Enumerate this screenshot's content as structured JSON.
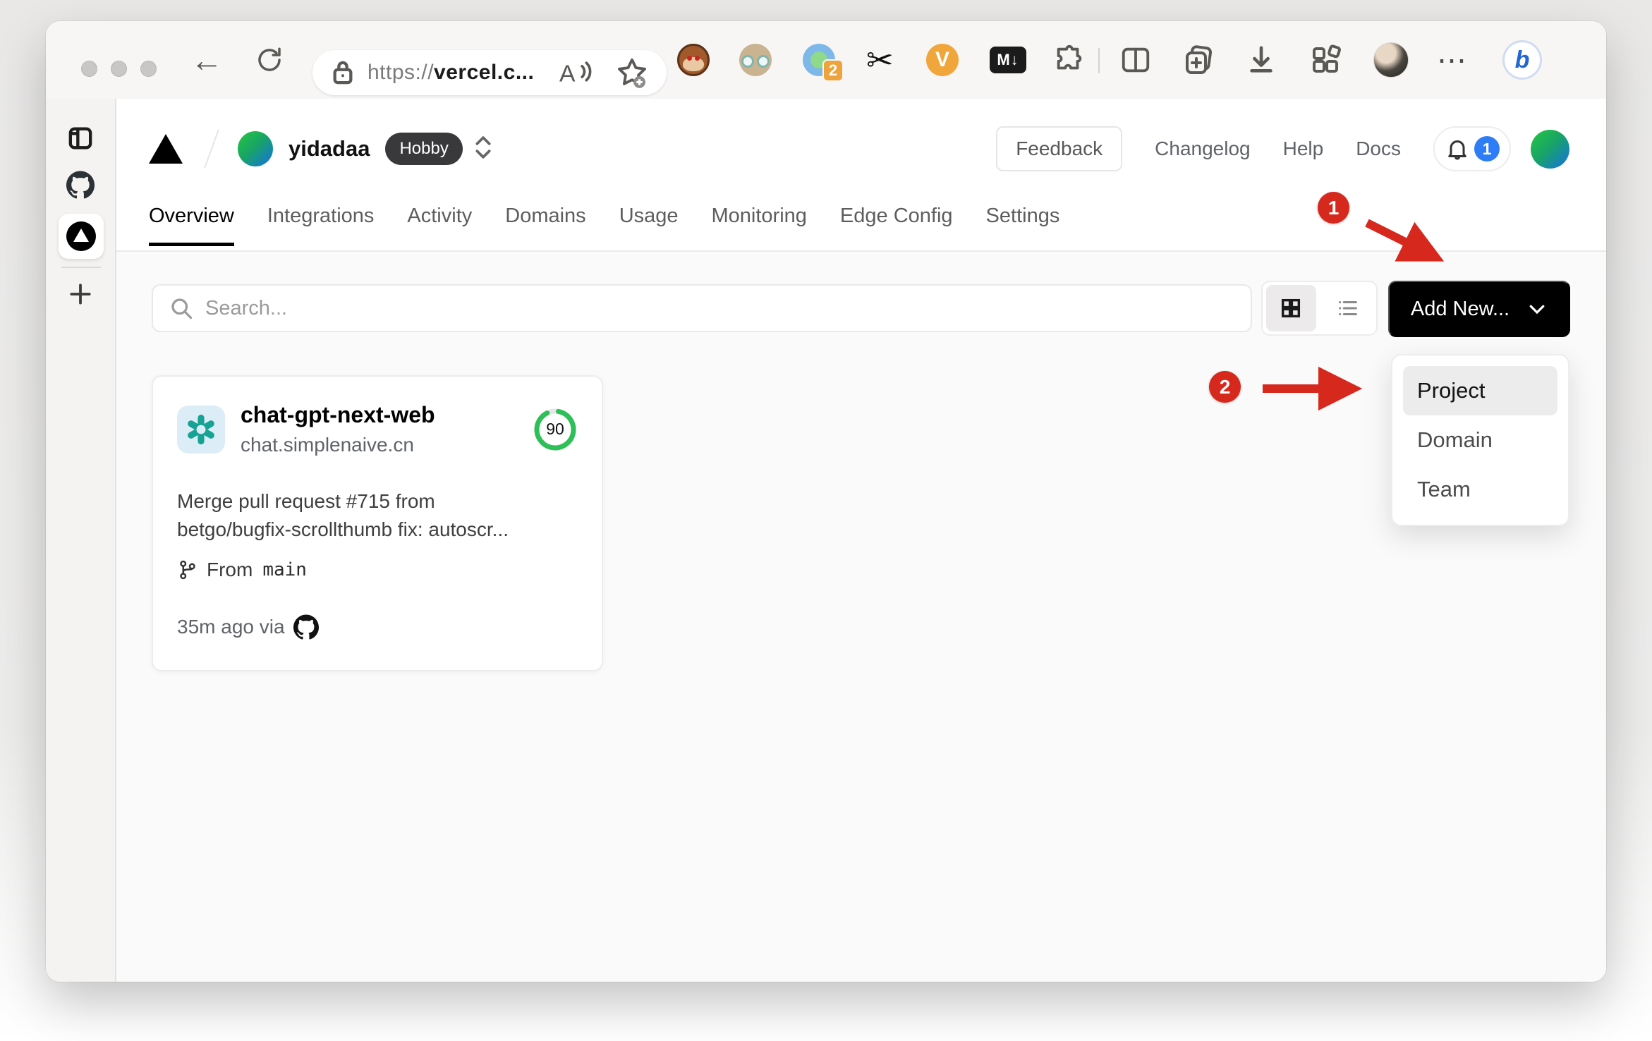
{
  "browser": {
    "url_scheme": "https://",
    "url_host": "vercel.c...",
    "translate_badge": "2",
    "capture_label": "V",
    "markdown_label": "M↓",
    "bing_label": "b"
  },
  "site_header": {
    "team_name": "yidadaa",
    "plan_badge": "Hobby",
    "feedback_label": "Feedback",
    "links": [
      "Changelog",
      "Help",
      "Docs"
    ],
    "bell_count": "1"
  },
  "tabs": [
    "Overview",
    "Integrations",
    "Activity",
    "Domains",
    "Usage",
    "Monitoring",
    "Edge Config",
    "Settings"
  ],
  "toolbar": {
    "search_placeholder": "Search...",
    "add_new_label": "Add New..."
  },
  "project_card": {
    "name": "chat-gpt-next-web",
    "domain": "chat.simplenaive.cn",
    "score": "90",
    "commit_line1": "Merge pull request #715 from",
    "commit_line2": "betgo/bugfix-scrollthumb fix: autoscr...",
    "from_label": "From",
    "branch": "main",
    "meta": "35m ago via"
  },
  "dropdown": {
    "items": [
      "Project",
      "Domain",
      "Team"
    ]
  },
  "annotations": {
    "step1": "1",
    "step2": "2"
  },
  "colors": {
    "annotation_red": "#d7281d",
    "score_green": "#2fbf58",
    "badge_blue": "#2e7df6"
  }
}
